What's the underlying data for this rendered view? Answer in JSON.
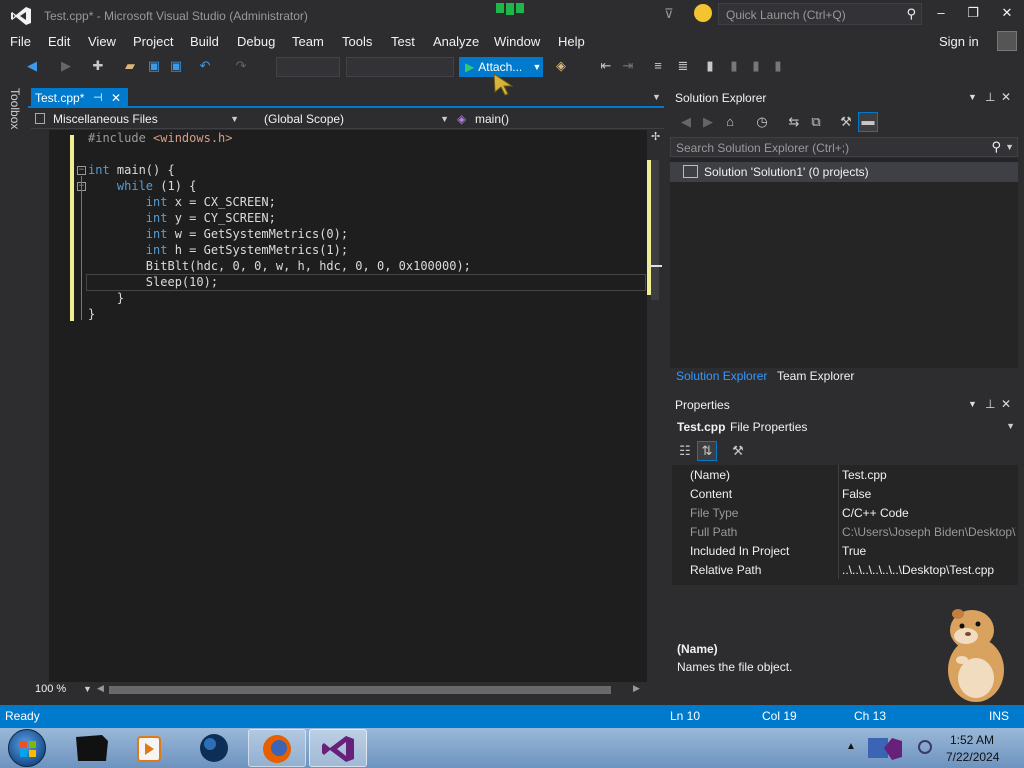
{
  "window": {
    "title": "Test.cpp* - Microsoft Visual Studio (Administrator)",
    "quick_launch_placeholder": "Quick Launch (Ctrl+Q)",
    "controls": {
      "minimize": "–",
      "restore": "❐",
      "close": "✕"
    }
  },
  "menu": {
    "items": [
      "File",
      "Edit",
      "View",
      "Project",
      "Build",
      "Debug",
      "Team",
      "Tools",
      "Test",
      "Analyze",
      "Window",
      "Help"
    ],
    "sign_in": "Sign in"
  },
  "toolbar": {
    "attach_label": "Attach..."
  },
  "toolbox": {
    "label": "Toolbox"
  },
  "editor": {
    "tab_label": "Test.cpp*",
    "nav": {
      "project": "Miscellaneous Files",
      "scope": "(Global Scope)",
      "member": "main()"
    },
    "code_lines": [
      "#include <windows.h>",
      "",
      "int main() {",
      "    while (1) {",
      "        int x = CX_SCREEN;",
      "        int y = CY_SCREEN;",
      "        int w = GetSystemMetrics(0);",
      "        int h = GetSystemMetrics(1);",
      "        BitBlt(hdc, 0, 0, w, h, hdc, 0, 0, 0x100000);",
      "        Sleep(10);",
      "    }",
      "}"
    ],
    "zoom": "100 %"
  },
  "solution_explorer": {
    "title": "Solution Explorer",
    "search_placeholder": "Search Solution Explorer (Ctrl+;)",
    "solution_node": "Solution 'Solution1' (0 projects)",
    "tabs": [
      "Solution Explorer",
      "Team Explorer"
    ]
  },
  "properties": {
    "title": "Properties",
    "object_name": "Test.cpp",
    "object_type": "File Properties",
    "rows": [
      {
        "name": "(Name)",
        "value": "Test.cpp"
      },
      {
        "name": "Content",
        "value": "False"
      },
      {
        "name": "File Type",
        "value": "C/C++ Code"
      },
      {
        "name": "Full Path",
        "value": "C:\\Users\\Joseph Biden\\Desktop\\Test.cpp"
      },
      {
        "name": "Included In Project",
        "value": "True"
      },
      {
        "name": "Relative Path",
        "value": "..\\..\\..\\..\\..\\..\\Desktop\\Test.cpp"
      }
    ],
    "description_title": "(Name)",
    "description_text": "Names the file object."
  },
  "status": {
    "ready": "Ready",
    "line": "Ln 10",
    "col": "Col 19",
    "ch": "Ch 13",
    "mode": "INS"
  },
  "taskbar": {
    "time": "1:52 AM",
    "date": "7/22/2024"
  },
  "colors": {
    "accent": "#007acc",
    "background": "#2d2d30",
    "editor_bg": "#1e1e1e",
    "keyword": "#569cd6",
    "change_marker": "#efef91"
  }
}
